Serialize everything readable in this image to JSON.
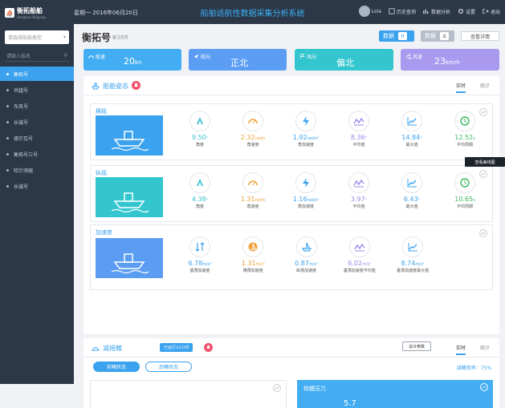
{
  "header": {
    "logo_text": "衡拓船舶",
    "logo_sub": "Hengtuo Shipping",
    "date": "星期一  2016年06月20日",
    "title": "船舶适航性数据采集分析系统",
    "user": "Lola",
    "history": "历史查询",
    "analysis": "数据分析",
    "settings": "设置",
    "logout": "退出"
  },
  "sidebar": {
    "type_placeholder": "请选择船舶类型",
    "search_placeholder": "请输入船名",
    "ships": [
      "衡拓号",
      "世越号",
      "东风号",
      "长城号",
      "德尔瓦号",
      "衡拓号三号",
      "哈尔滨舰",
      "长城号"
    ]
  },
  "main": {
    "ship_name": "衡拓号",
    "note": "备注信息",
    "toggle1": {
      "label": "数据",
      "state": "开"
    },
    "toggle2": {
      "label": "数据",
      "state": "关"
    },
    "detail_btn": "查看详情",
    "stats": [
      {
        "label": "航速",
        "value": "20",
        "unit": "kn"
      },
      {
        "label": "航向",
        "value": "正北",
        "unit": ""
      },
      {
        "label": "风向",
        "value": "偏北",
        "unit": ""
      },
      {
        "label": "风速",
        "value": "23",
        "unit": "km/h"
      }
    ]
  },
  "panel1": {
    "title": "船舶姿态",
    "tabs": [
      "实时",
      "统计"
    ],
    "sections": [
      {
        "title": "横摇",
        "metrics": [
          {
            "value": "9.50",
            "unit": "°",
            "label": "角度",
            "color": "#36c0cf"
          },
          {
            "value": "2.32",
            "unit": "rad/s",
            "label": "角速度",
            "color": "#f0a23b"
          },
          {
            "value": "1.92",
            "unit": "rad/s²",
            "label": "角加速度",
            "color": "#3aa2ee"
          },
          {
            "value": "8.36",
            "unit": "°",
            "label": "平均值",
            "color": "#9b87e8"
          },
          {
            "value": "14.84",
            "unit": "°",
            "label": "最大值",
            "color": "#3aa2ee"
          },
          {
            "value": "12.52",
            "unit": "s",
            "label": "平均周期",
            "color": "#3cba5f"
          }
        ]
      },
      {
        "title": "纵摇",
        "metrics": [
          {
            "value": "4.38",
            "unit": "°",
            "label": "角度",
            "color": "#36c0cf"
          },
          {
            "value": "1.31",
            "unit": "rad/s",
            "label": "角速度",
            "color": "#f0a23b"
          },
          {
            "value": "1.16",
            "unit": "rad/s²",
            "label": "角加速度",
            "color": "#3aa2ee"
          },
          {
            "value": "3.97",
            "unit": "°",
            "label": "平均值",
            "color": "#9b87e8"
          },
          {
            "value": "6.43",
            "unit": "°",
            "label": "最大值",
            "color": "#3aa2ee"
          },
          {
            "value": "10.65",
            "unit": "s",
            "label": "平均周期",
            "color": "#3cba5f"
          }
        ]
      },
      {
        "title": "加速度",
        "metrics": [
          {
            "value": "6.78",
            "unit": "m/s²",
            "label": "垂荡加速度",
            "color": "#3aa2ee"
          },
          {
            "value": "1.31",
            "unit": "m/s²",
            "label": "横荡加速度",
            "color": "#f0a23b"
          },
          {
            "value": "0.87",
            "unit": "m/s²",
            "label": "纵荡加速度",
            "color": "#3aa2ee"
          },
          {
            "value": "6.02",
            "unit": "m/s²",
            "label": "垂荡加速度平均值",
            "color": "#9b87e8"
          },
          {
            "value": "8.74",
            "unit": "m/s²",
            "label": "垂荡加速度最大值",
            "color": "#3aa2ee"
          }
        ]
      }
    ],
    "tooltip": "查看曲线图"
  },
  "panel2": {
    "title": "减摇鳍",
    "badge": "已运行12小时",
    "design_btn": "设计参数",
    "tabs": [
      "实时",
      "统计"
    ],
    "sub_tabs": [
      "前鳍状态",
      "后鳍状态"
    ],
    "rate_label": "减鳍效率：75%",
    "pressure_title": "转鳍压力",
    "pressure_value": "5.7"
  }
}
